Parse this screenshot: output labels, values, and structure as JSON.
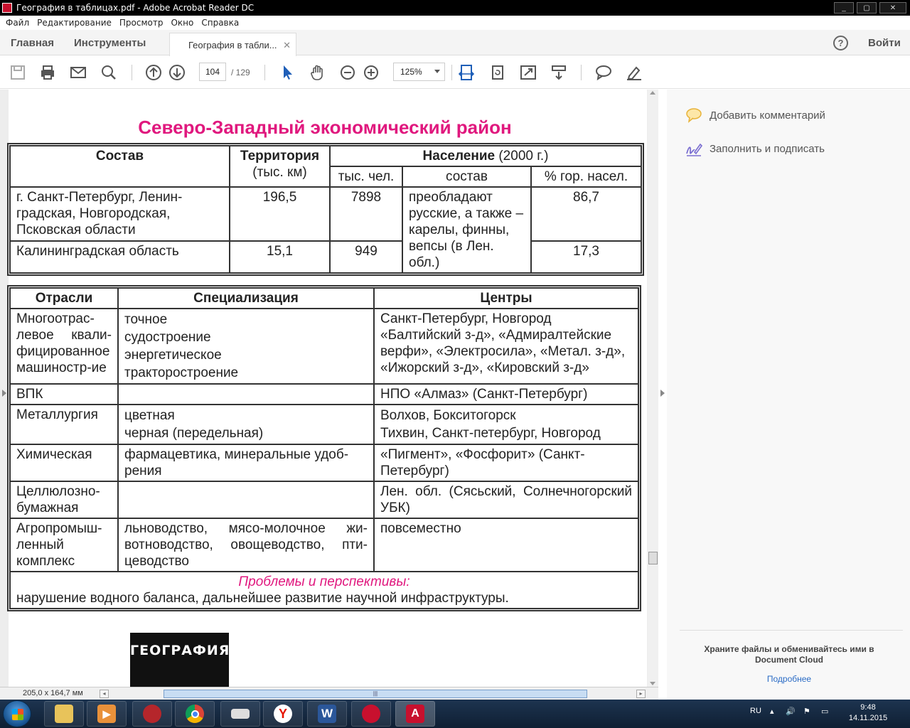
{
  "window": {
    "title": "География в таблицах.pdf - Adobe Acrobat Reader DC"
  },
  "menu": [
    "Файл",
    "Редактирование",
    "Просмотр",
    "Окно",
    "Справка"
  ],
  "nav": {
    "home": "Главная",
    "tools": "Инструменты",
    "doc_tab": "География в табли...",
    "login": "Войти",
    "help": "?"
  },
  "toolbar": {
    "page_current": "104",
    "page_total": "/ 129",
    "zoom": "125%"
  },
  "page": {
    "title": "Северо-Западный экономический район",
    "table1": {
      "h_sostav": "Состав",
      "h_terr": "Территория",
      "h_terr_unit": "(тыс. км)",
      "h_pop": "Население",
      "h_pop_year": "(2000 г.)",
      "sub_thous": "тыс. чел.",
      "sub_comp": "состав",
      "sub_urban": "% гор. насел.",
      "rows": [
        {
          "name": "г. Санкт-Петербург, Ленин-градская, Новгородская, Псковская области",
          "terr": "196,5",
          "pop": "7898",
          "urban": "86,7"
        },
        {
          "name": "Калининградская область",
          "terr": "15,1",
          "pop": "949",
          "urban": "17,3"
        }
      ],
      "composition": "преобладают русские, а также – карелы, финны, вепсы (в Лен. обл.)"
    },
    "table2": {
      "h_branch": "Отрасли",
      "h_spec": "Специализация",
      "h_centers": "Центры",
      "rows": [
        {
          "branch": "Многоотрас-левое квали-фицированное машиностр-ие",
          "spec": "точное\nсудостроение\nэнергетическое\nтракторостроение",
          "centers": "Санкт-Петербург, Новгород\n«Балтийский з-д», «Адмиралтейские верфи», «Электросила», «Метал. з-д», «Ижорский з-д», «Кировский з-д»"
        },
        {
          "branch": "ВПК",
          "spec": "",
          "centers": "НПО «Алмаз» (Санкт-Петербург)"
        },
        {
          "branch": "Металлургия",
          "spec": "цветная\nчерная (передельная)",
          "centers": "Волхов, Бокситогорск\nТихвин, Санкт-петербург, Новгород"
        },
        {
          "branch": "Химическая",
          "spec": "фармацевтика, минеральные удоб-рения",
          "centers": "«Пигмент», «Фосфорит» (Санкт-Петербург)"
        },
        {
          "branch": "Целлюлозно-бумажная",
          "spec": "",
          "centers": "Лен. обл. (Сясьский, Солнечногорский УБК)"
        },
        {
          "branch": "Агропромыш-ленный комплекс",
          "spec": "льноводство, мясо-молочное жи-вотноводство, овощеводство, пти-цеводство",
          "centers": "повсеместно"
        }
      ],
      "problems_label": "Проблемы и перспективы:",
      "problems_text": "нарушение водного баланса, дальнейшее развитие научной инфраструктуры."
    },
    "logo_text": "ГЕОГРАФИЯ"
  },
  "right_pane": {
    "add_comment": "Добавить комментарий",
    "fill_sign": "Заполнить и подписать",
    "cloud_text": "Храните файлы и обменивайтесь ими в Document Cloud",
    "more": "Подробнее"
  },
  "status": {
    "dims": "205,0 x 164,7 мм"
  },
  "taskbar": {
    "lang": "RU",
    "time": "9:48",
    "date": "14.11.2015"
  },
  "colors": {
    "accent_pink": "#e0187e",
    "acrobat_red": "#c8102e",
    "link_blue": "#2a6bc5"
  }
}
